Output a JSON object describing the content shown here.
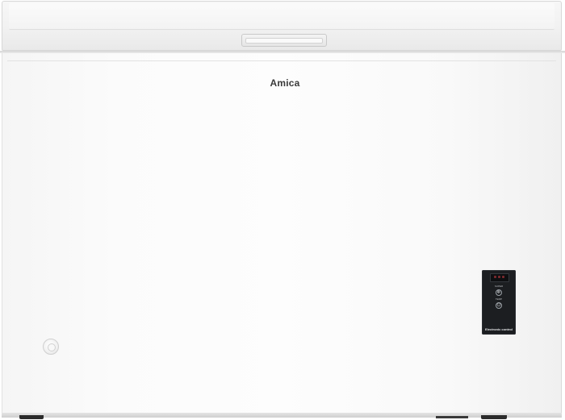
{
  "product": {
    "brand": "Amica",
    "type": "chest-freezer",
    "colors": {
      "body": "#fcfcfc",
      "control_panel": "#1c1e21",
      "brand_text": "#3a3a3a"
    }
  },
  "control_panel": {
    "label_top": "SUPER",
    "label_bottom": "TEMP",
    "footer": "Electronic control",
    "icons": [
      "snowflake-icon",
      "power-icon"
    ]
  }
}
